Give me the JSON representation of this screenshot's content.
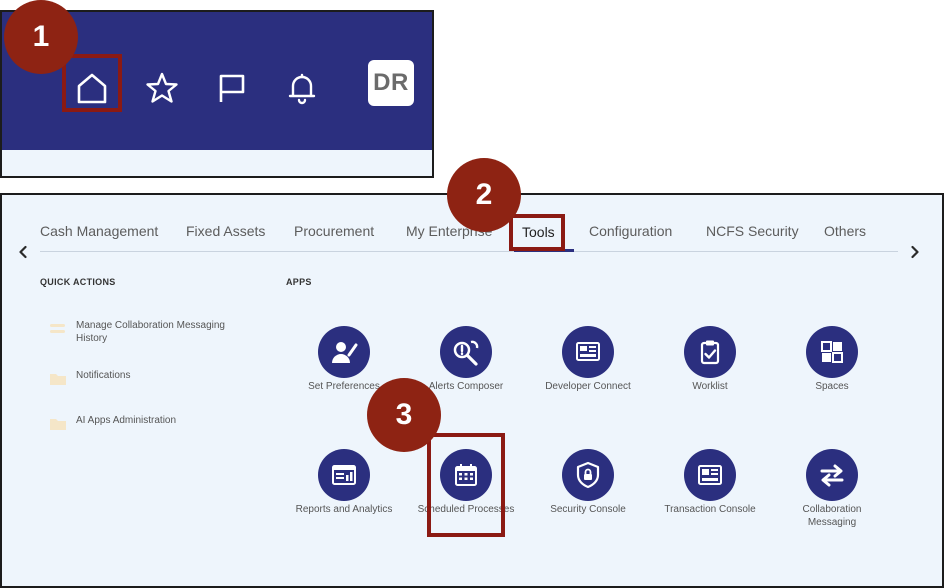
{
  "steps": {
    "one": "1",
    "two": "2",
    "three": "3"
  },
  "header": {
    "avatar_initials": "DR",
    "icons": [
      "home-icon",
      "star-icon",
      "flag-icon",
      "bell-icon"
    ]
  },
  "tabs": {
    "items": [
      "Cash Management",
      "Fixed Assets",
      "Procurement",
      "My Enterprise",
      "Tools",
      "Configuration",
      "NCFS Security",
      "Others"
    ],
    "active": "Tools"
  },
  "quick_actions": {
    "title": "QUICK ACTIONS",
    "items": [
      "Manage Collaboration Messaging History",
      "Notifications",
      "AI Apps Administration"
    ]
  },
  "apps": {
    "title": "APPS",
    "items": [
      {
        "label": "Set Preferences",
        "icon": "user-pen-icon"
      },
      {
        "label": "Alerts Composer",
        "icon": "alert-wrench-icon"
      },
      {
        "label": "Developer Connect",
        "icon": "dashboard-icon"
      },
      {
        "label": "Worklist",
        "icon": "clipboard-check-icon"
      },
      {
        "label": "Spaces",
        "icon": "grid-icon"
      },
      {
        "label": "Reports and Analytics",
        "icon": "report-icon"
      },
      {
        "label": "Scheduled Processes",
        "icon": "calendar-icon"
      },
      {
        "label": "Security Console",
        "icon": "shield-lock-icon"
      },
      {
        "label": "Transaction Console",
        "icon": "console-icon"
      },
      {
        "label": "Collaboration Messaging",
        "icon": "swap-arrows-icon"
      }
    ]
  },
  "colors": {
    "navbar": "#2b2f7f",
    "highlight": "#8b1a13",
    "badge": "#8e2313",
    "panel_bg": "#eef5fc"
  }
}
